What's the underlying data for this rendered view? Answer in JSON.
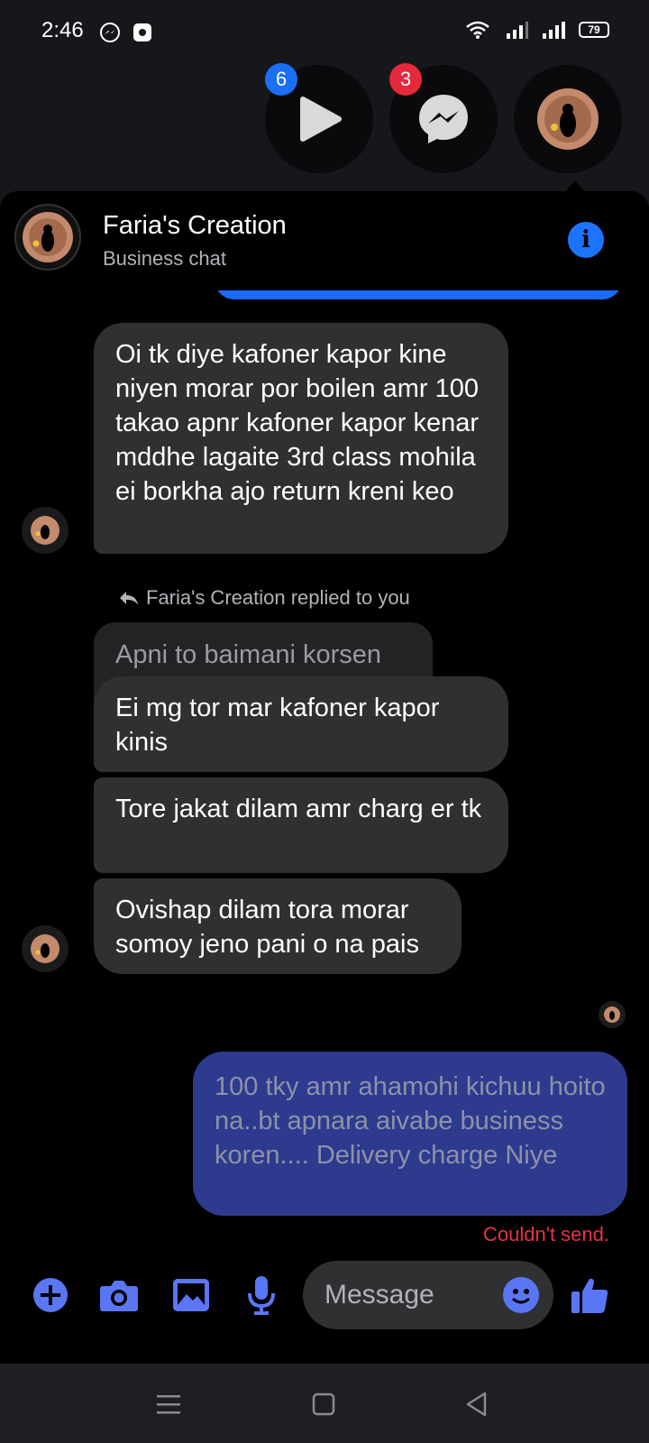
{
  "status_bar": {
    "time": "2:46",
    "battery": "79"
  },
  "chat_heads": [
    {
      "name": "video-play",
      "badge": "6",
      "badge_color": "#1a6ff2"
    },
    {
      "name": "messenger",
      "badge": "3",
      "badge_color": "#e6283b"
    },
    {
      "name": "faria-creation",
      "badge": ""
    }
  ],
  "header": {
    "title": "Faria's Creation",
    "subtitle": "Business chat"
  },
  "messages": [
    {
      "from": "them",
      "text": "Oi tk diye kafoner kapor kine niyen morar por boilen amr 100 takao apnr kafoner kapor kenar mddhe lagaite 3rd class mohila ei borkha ajo return kreni keo"
    },
    {
      "from": "them",
      "text": "Ei mg tor mar kafoner kapor kinis"
    },
    {
      "from": "them",
      "text": "Tore jakat dilam amr charg er tk"
    },
    {
      "from": "them",
      "text": "Ovishap dilam tora morar somoy jeno pani o na pais"
    }
  ],
  "reply": {
    "label": "Faria's Creation replied to you",
    "quoted": "Apni to baimani korsen"
  },
  "sent_message": {
    "text": "100 tky amr ahamohi kichuu hoito na..bt apnara aivabe business koren.... Delivery charge Niye",
    "status": "Couldn't send."
  },
  "composer": {
    "placeholder": "Message"
  },
  "colors": {
    "accent": "#1b74ff",
    "sent_bubble": "#2d3a8e",
    "received_bubble": "#303033",
    "error": "#e83345",
    "composer_icon": "#5a76f5"
  }
}
